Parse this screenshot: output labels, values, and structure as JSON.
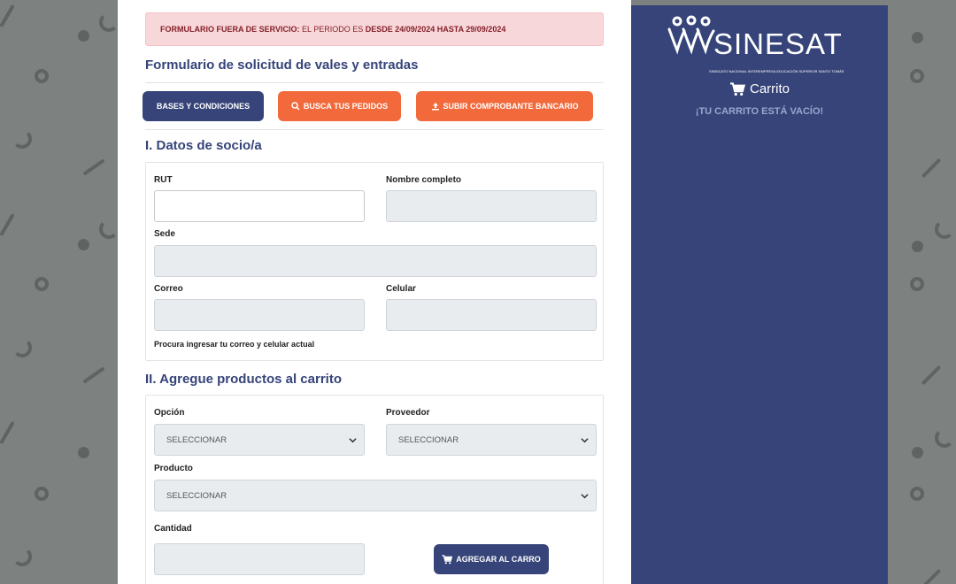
{
  "alert": {
    "lead": "FORMULARIO FUERA DE SERVICIO:",
    "middle": "EL PERIODO ES",
    "dates": "DESDE 24/09/2024 HASTA 29/09/2024"
  },
  "form_title": "Formulario de solicitud de vales y entradas",
  "buttons": {
    "bases": "BASES Y CONDICIONES",
    "search": "BUSCA TUS PEDIDOS",
    "upload": "SUBIR COMPROBANTE BANCARIO"
  },
  "section1": {
    "title": "I. Datos de socio/a",
    "rut_label": "RUT",
    "rut_value": "",
    "name_label": "Nombre completo",
    "name_value": "",
    "sede_label": "Sede",
    "sede_value": "",
    "email_label": "Correo",
    "email_value": "",
    "phone_label": "Celular",
    "phone_value": "",
    "hint": "Procura ingresar tu correo y celular actual"
  },
  "section2": {
    "title": "II. Agregue productos al carrito",
    "option_label": "Opción",
    "option_value": "SELECCIONAR",
    "provider_label": "Proveedor",
    "provider_value": "SELECCIONAR",
    "product_label": "Producto",
    "product_value": "SELECCIONAR",
    "qty_label": "Cantidad",
    "qty_value": "",
    "add_button": "AGREGAR AL CARRO"
  },
  "sidebar": {
    "logo_text": "SINESAT",
    "logo_sub": "SINDICATO NACIONAL INTEREMPRESA EDUCACIÓN SUPERIOR SANTO TOMÁS",
    "cart_title": "Carrito",
    "cart_empty": "¡TU CARRITO ESTÁ VACÍO!"
  },
  "colors": {
    "navy": "#364479",
    "orange": "#f26a3c",
    "alert_bg": "#f8d7da",
    "alert_text": "#842029"
  },
  "icons": [
    "search-icon",
    "upload-icon",
    "cart-icon",
    "chevron-down-icon",
    "sinesat-logo-icon"
  ]
}
